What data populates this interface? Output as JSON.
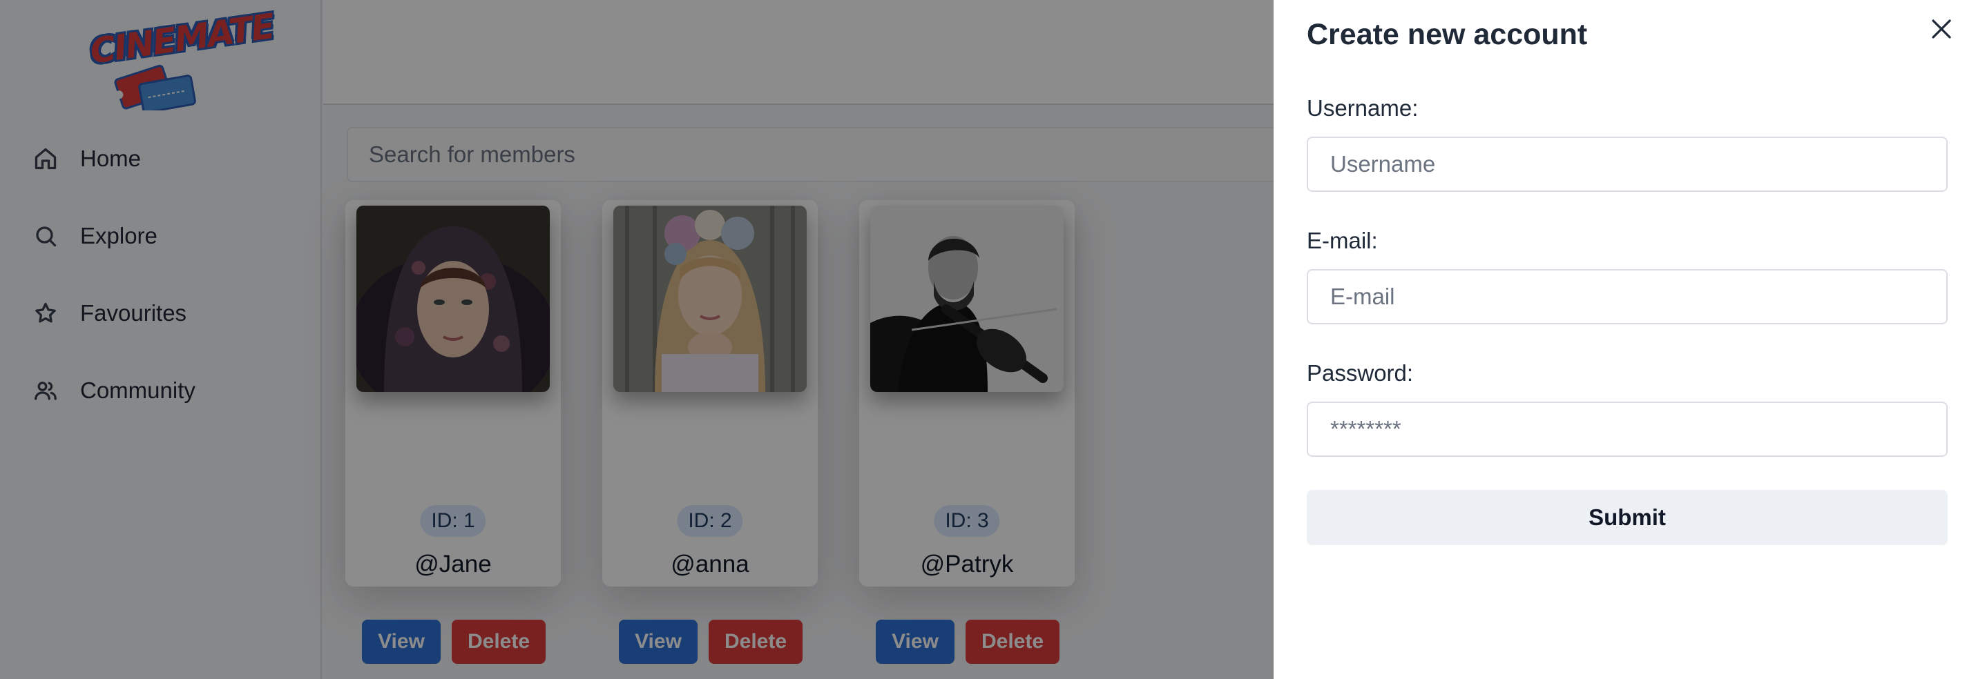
{
  "sidebar": {
    "logo_text": "CINEMATE",
    "items": [
      {
        "label": "Home",
        "icon": "home-icon"
      },
      {
        "label": "Explore",
        "icon": "search-icon"
      },
      {
        "label": "Favourites",
        "icon": "star-icon"
      },
      {
        "label": "Community",
        "icon": "users-icon"
      }
    ]
  },
  "search": {
    "placeholder": "Search for members"
  },
  "members": [
    {
      "id_label": "ID: 1",
      "handle": "@Jane",
      "view_label": "View",
      "delete_label": "Delete"
    },
    {
      "id_label": "ID: 2",
      "handle": "@anna",
      "view_label": "View",
      "delete_label": "Delete"
    },
    {
      "id_label": "ID: 3",
      "handle": "@Patryk",
      "view_label": "View",
      "delete_label": "Delete"
    }
  ],
  "drawer": {
    "title": "Create new account",
    "username_label": "Username:",
    "username_placeholder": "Username",
    "email_label": "E-mail:",
    "email_placeholder": "E-mail",
    "password_label": "Password:",
    "password_placeholder": "********",
    "submit_label": "Submit"
  },
  "colors": {
    "primary": "#2f6fd6",
    "danger": "#dc3b3b",
    "badge_bg": "#dbeafe"
  }
}
